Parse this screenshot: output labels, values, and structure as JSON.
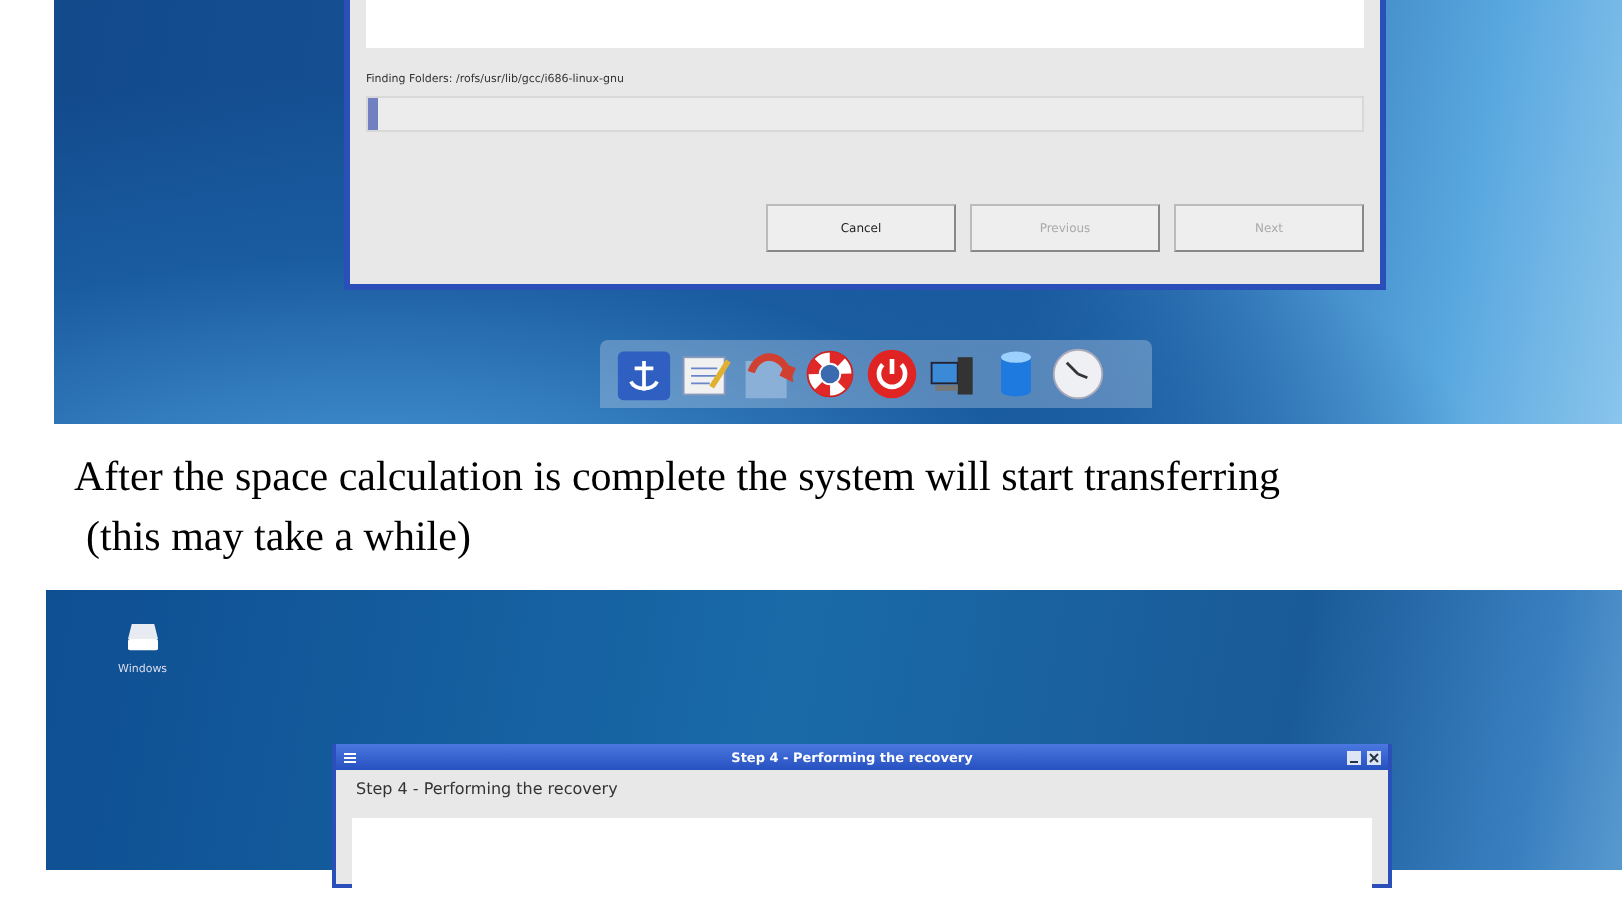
{
  "screenshot_1": {
    "dialog": {
      "status": "Finding Folders: /rofs/usr/lib/gcc/i686-linux-gnu",
      "progress": {
        "level": 0.01
      },
      "buttons": [
        {
          "label": "Cancel",
          "disabled": false
        },
        {
          "label": "Previous",
          "disabled": true
        },
        {
          "label": "Next",
          "disabled": true
        }
      ]
    }
  },
  "paragraph": {
    "lines": [
      "After the space calculation is complete the system will start transferring",
      "(this may take a while)"
    ]
  },
  "screenshot_2": {
    "desktop_icons": [
      {
        "label": "Windows"
      }
    ],
    "dialog": {
      "title": "Step 4 - Performing the recovery",
      "heading": "Step 4 - Performing the recovery"
    }
  }
}
